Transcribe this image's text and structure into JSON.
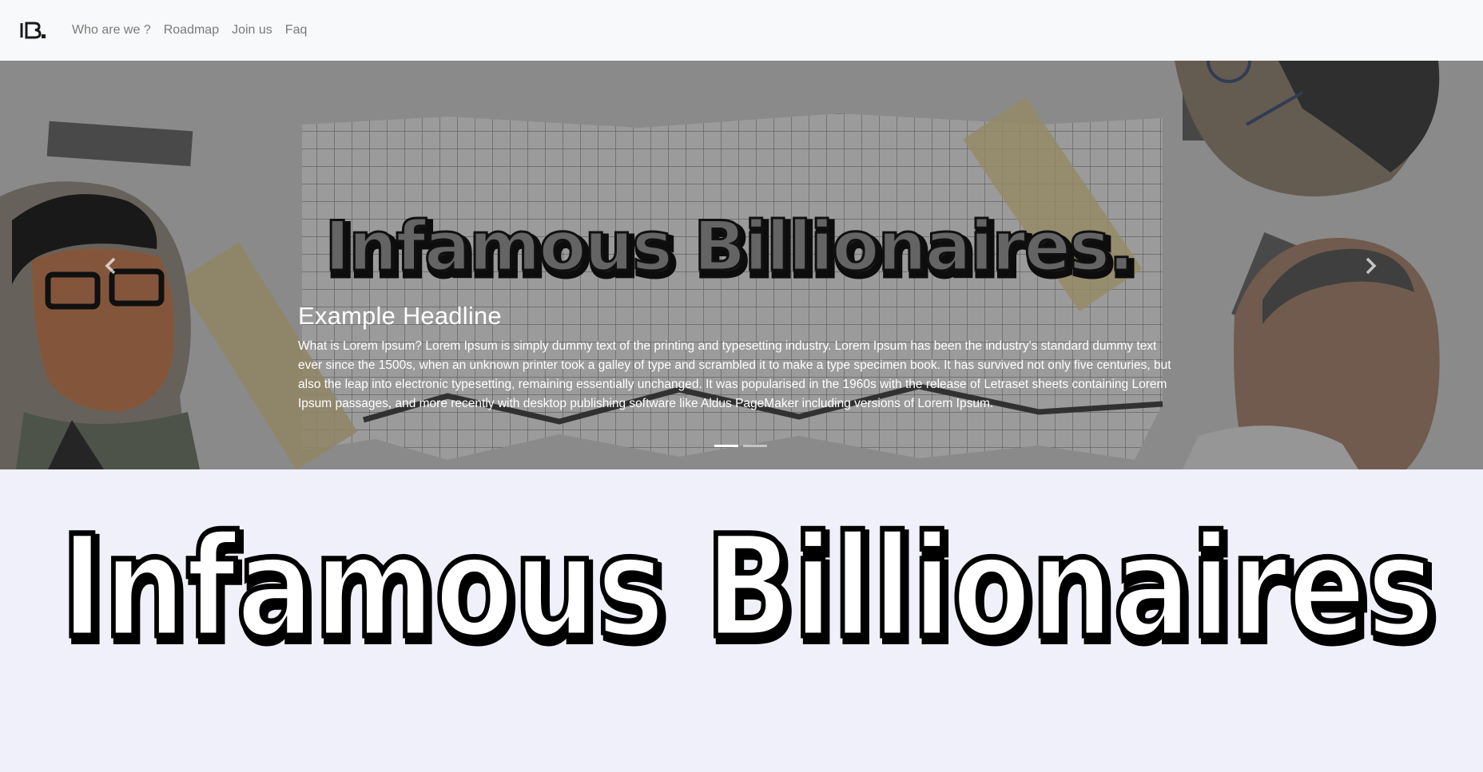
{
  "navbar": {
    "brand_logo_text": "IB.",
    "links": [
      {
        "label": "Who are we ?"
      },
      {
        "label": "Roadmap"
      },
      {
        "label": "Join us"
      },
      {
        "label": "Faq"
      }
    ]
  },
  "carousel": {
    "banner_text": "Infamous Billionaires.",
    "slides": [
      {
        "headline": "Example Headline",
        "text": "What is Lorem Ipsum? Lorem Ipsum is simply dummy text of the printing and typesetting industry. Lorem Ipsum has been the industry's standard dummy text ever since the 1500s, when an unknown printer took a galley of type and scrambled it to make a type specimen book. It has survived not only five centuries, but also the leap into electronic typesetting, remaining essentially unchanged. It was popularised in the 1960s with the release of Letraset sheets containing Lorem Ipsum passages, and more recently with desktop publishing software like Aldus PageMaker including versions of Lorem Ipsum."
      },
      {}
    ],
    "active_slide_index": 0,
    "prev_icon": "chevron-left-icon",
    "next_icon": "chevron-right-icon"
  },
  "hero": {
    "title": "Infamous Billionaires"
  },
  "colors": {
    "page_background": "#f0f0fa",
    "navbar_background": "#f8f9fa",
    "nav_link": "#7a7a7a",
    "caption_text": "#ffffff",
    "title_fill": "#ffffff",
    "title_outline": "#000000"
  }
}
